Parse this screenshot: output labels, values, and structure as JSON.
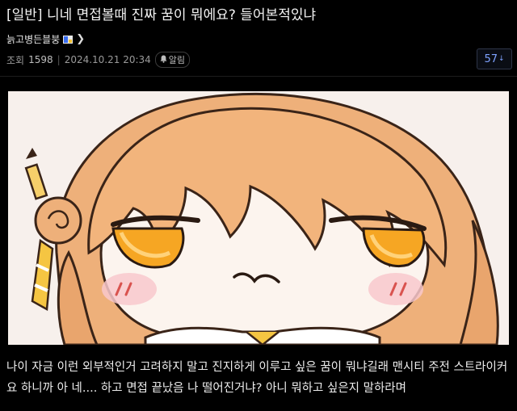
{
  "post": {
    "title": "[일반] 니네 면접볼때 진짜 꿈이 뭐에요? 들어본적있냐",
    "author": "늙고병든블붕",
    "views_label": "조회",
    "views": "1598",
    "date": "2024.10.21 20:34",
    "alarm_label": "알림",
    "reply_count": "57",
    "body": "나이 자금 이런 외부적인거 고려하지 말고 진지하게 이루고 싶은 꿈이 뭐냐길래 맨시티 주전 스트라이커요 하니까 아 네.... 하고 면접 끝났음 나 떨어진거냐? 아니 뭐하고 싶은지 말하라며"
  },
  "icons": {
    "gallery": "gallery-badge-icon",
    "chevron": "chevron-right-icon",
    "bell": "bell-icon",
    "arrow": "arrow-down-icon"
  },
  "colors": {
    "background": "#000000",
    "accent": "#7ea2ff",
    "hair": "#f0b47e",
    "eye": "#f5a623"
  }
}
